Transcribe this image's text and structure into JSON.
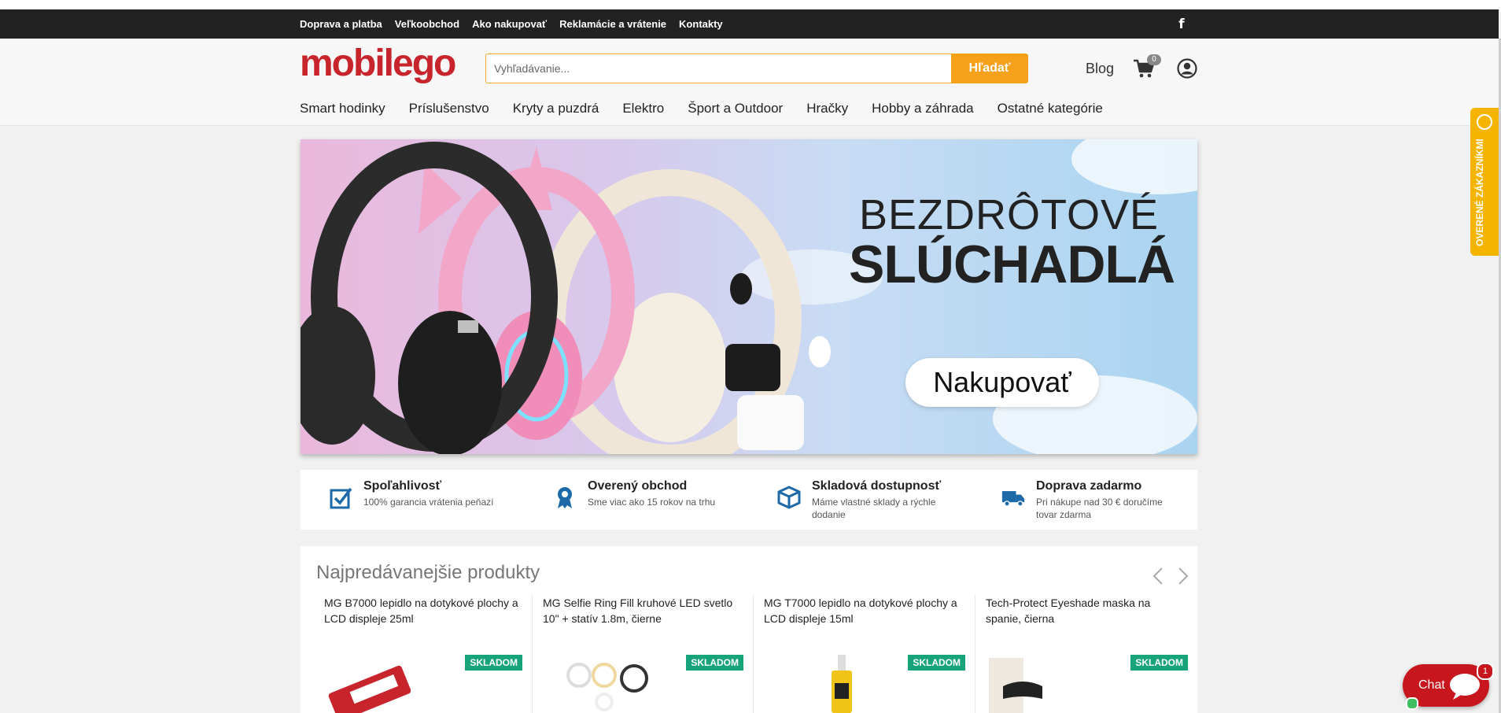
{
  "topbar": {
    "links": [
      "Doprava a platba",
      "Veľkoobchod",
      "Ako nakupovať",
      "Reklamácie a vrátenie",
      "Kontakty"
    ],
    "facebook_icon": "facebook-icon"
  },
  "header": {
    "logo": "mobilego",
    "search_placeholder": "Vyhľadávanie...",
    "search_button": "Hľadať",
    "blog": "Blog",
    "cart_count": "0"
  },
  "nav": [
    "Smart hodinky",
    "Príslušenstvo",
    "Kryty a puzdrá",
    "Elektro",
    "Šport a Outdoor",
    "Hračky",
    "Hobby a záhrada",
    "Ostatné kategórie"
  ],
  "banner": {
    "line1": "BEZDRÔTOVÉ",
    "line2": "SLÚCHADLÁ",
    "button": "Nakupovať"
  },
  "features": [
    {
      "title": "Spoľahlivosť",
      "desc": "100% garancia vrátenia peňazí",
      "icon": "checkbox-icon"
    },
    {
      "title": "Overený obchod",
      "desc": "Sme viac ako 15 rokov na trhu",
      "icon": "ribbon-icon"
    },
    {
      "title": "Skladová dostupnosť",
      "desc": "Máme vlastné sklady a rýchle dodanie",
      "icon": "box-icon"
    },
    {
      "title": "Doprava zadarmo",
      "desc": "Pri nákupe nad 30 € doručíme tovar zdarma",
      "icon": "truck-icon"
    }
  ],
  "bestsellers": {
    "title": "Najpredávanejšie produkty",
    "products": [
      {
        "name": "MG B7000 lepidlo na dotykové plochy a LCD displeje 25ml",
        "badge": "SKLADOM"
      },
      {
        "name": "MG Selfie Ring Fill kruhové LED svetlo 10\" + statív 1.8m, čierne",
        "badge": "SKLADOM"
      },
      {
        "name": "MG T7000 lepidlo na dotykové plochy a LCD displeje 15ml",
        "badge": "SKLADOM"
      },
      {
        "name": "Tech-Protect Eyeshade maska na spanie, čierna",
        "badge": "SKLADOM"
      }
    ]
  },
  "trust_badge": "OVERENÉ ZÁKAZNÍKMI",
  "chat": {
    "label": "Chat",
    "count": "1"
  },
  "colors": {
    "brand_red": "#c8242b",
    "accent_orange": "#f5a11a",
    "stock_green": "#17a47a",
    "trust_yellow": "#f5b400"
  }
}
